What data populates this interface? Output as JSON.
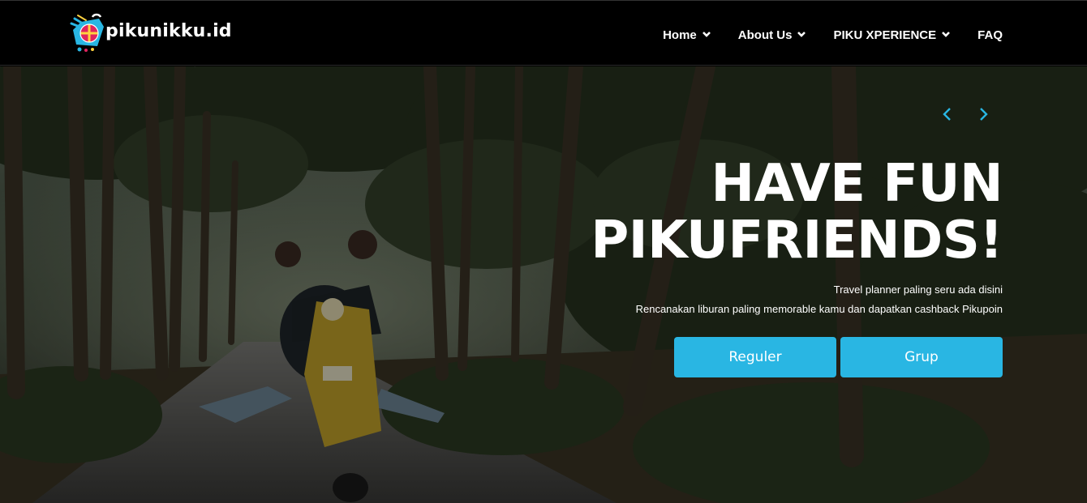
{
  "brand": {
    "name": "pikunikku.id",
    "accent": "#29b6e3"
  },
  "nav": {
    "items": [
      {
        "label": "Home",
        "has_dropdown": true
      },
      {
        "label": "About Us",
        "has_dropdown": true
      },
      {
        "label": "PIKU XPERIENCE",
        "has_dropdown": true
      },
      {
        "label": "FAQ",
        "has_dropdown": false
      }
    ]
  },
  "hero": {
    "title_line1": "HAVE FUN",
    "title_line2": "PIKUFRIENDS!",
    "subtitle_line1": "Travel planner paling seru ada disini",
    "subtitle_line2": "Rencanakan liburan paling memorable kamu dan dapatkan cashback Pikupoin",
    "buttons": {
      "reguler": "Reguler",
      "grup": "Grup"
    },
    "carousel": {
      "prev_icon": "chevron-left-icon",
      "next_icon": "chevron-right-icon"
    }
  }
}
